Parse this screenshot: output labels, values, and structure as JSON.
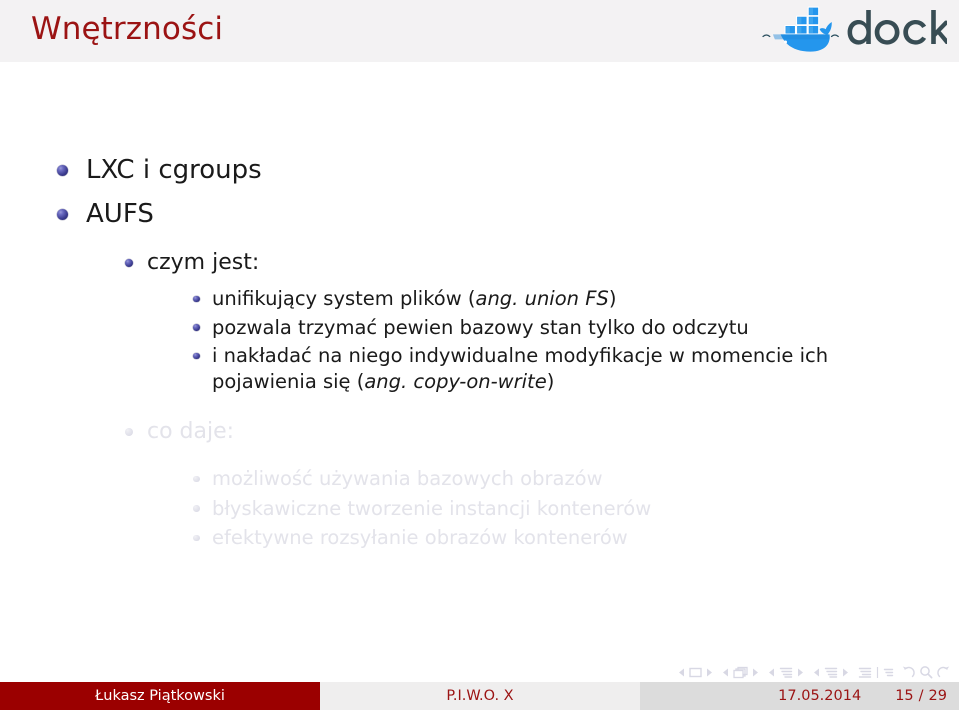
{
  "header": {
    "title": "Wnętrzności",
    "title_color": "#9b1313",
    "band_color": "#f3f2f3",
    "logo": {
      "name": "docker-logo",
      "wordmark": "docker",
      "wordmark_color": "#384d54",
      "whale_color": "#2496ed",
      "whale_dark": "#1f7fc4"
    }
  },
  "slide": {
    "items": [
      {
        "level": 1,
        "text": "LXC i cgroups",
        "dimmed": false
      },
      {
        "level": 1,
        "text": "AUFS",
        "dimmed": false
      },
      {
        "level": 2,
        "text": "czym jest:",
        "dimmed": false
      },
      {
        "level": 3,
        "text": "unifikujący system plików (ang. union FS)",
        "dimmed": false
      },
      {
        "level": 3,
        "text": "pozwala trzymać pewien bazowy stan tylko do odczytu",
        "dimmed": false
      },
      {
        "level": 3,
        "text": "i nakładać na niego indywidualne modyfikacje w momencie ich pojawienia się (ang. copy-on-write)",
        "dimmed": false
      },
      {
        "level": 2,
        "text": "co daje:",
        "dimmed": true
      },
      {
        "level": 3,
        "text": "możliwość używania bazowych obrazów",
        "dimmed": true
      },
      {
        "level": 3,
        "text": "błyskawiczne tworzenie instancji kontenerów",
        "dimmed": true
      },
      {
        "level": 3,
        "text": "efektywne rozsyłanie obrazów kontenerów",
        "dimmed": true
      }
    ],
    "parts": {
      "b1": "LXC i cgroups",
      "b2": "AUFS",
      "b3": "czym jest:",
      "b4_a": "unifikujący system plików (",
      "b4_it": "ang. union FS",
      "b4_b": ")",
      "b5": "pozwala trzymać pewien bazowy stan tylko do odczytu",
      "b6_l1": "i nakładać na niego indywidualne modyfikacje w momencie ich",
      "b6_l2_a": "pojawienia się (",
      "b6_l2_it": "ang. copy-on-write",
      "b6_l2_b": ")",
      "b7": "co daje:",
      "b8": "możliwość używania bazowych obrazów",
      "b9": "błyskawiczne tworzenie instancji kontenerów",
      "b10": "efektywne rozsyłanie obrazów kontenerów"
    },
    "dim_color": "#e3e3ea",
    "bullet_color": "#3b3b8f"
  },
  "navigation": {
    "icons": [
      "prev-slide-arrow-icon",
      "slide-icon",
      "next-slide-arrow-icon",
      "prev-frame-arrow-icon",
      "frames-icon",
      "next-frame-arrow-icon",
      "prev-subsection-arrow-icon",
      "subsection-icon",
      "next-subsection-arrow-icon",
      "prev-section-arrow-icon",
      "section-icon",
      "next-section-arrow-icon",
      "beginning-of-section-icon",
      "end-of-section-icon",
      "back-icon",
      "search-icon",
      "forward-icon"
    ],
    "color": "#d8d8e4"
  },
  "footer": {
    "author": "Łukasz Piątkowski",
    "title": "P.I.W.O. X",
    "date": "17.05.2014",
    "page_current": "15",
    "page_separator": "/",
    "page_total": "29",
    "author_bg": "#9b0000",
    "title_bg": "#efeeee",
    "meta_bg": "#dcdcdc",
    "accent": "#9b1313"
  }
}
